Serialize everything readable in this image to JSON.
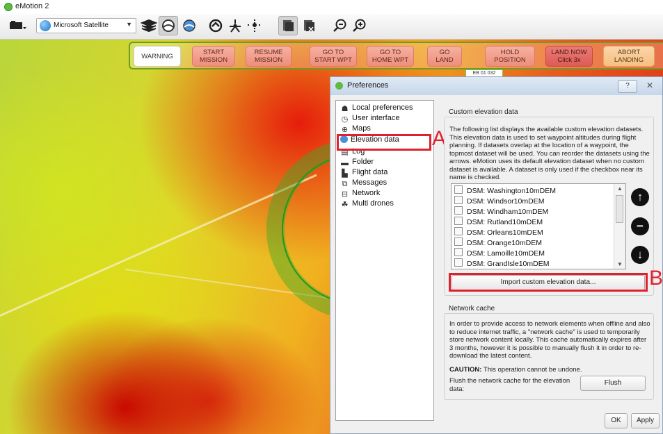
{
  "app": {
    "title": "eMotion 2"
  },
  "toolbar": {
    "map_source": "Microsoft Satellite",
    "icons": [
      "drone-menu-icon",
      "layers-icon",
      "elevation-icon",
      "elevation-alt-icon",
      "launch-icon",
      "hover-drone-icon",
      "altitude-drone-icon",
      "flight-plan-icon",
      "flight-plan-alt-icon",
      "zoom-out-icon",
      "zoom-in-icon"
    ]
  },
  "commands": [
    {
      "line1": "WARNING",
      "line2": ""
    },
    {
      "line1": "START",
      "line2": "MISSION"
    },
    {
      "line1": "RESUME",
      "line2": "MISSION"
    },
    {
      "line1": "GO TO",
      "line2": "START WPT"
    },
    {
      "line1": "GO TO",
      "line2": "HOME WPT"
    },
    {
      "line1": "GO",
      "line2": "LAND"
    },
    {
      "line1": "HOLD",
      "line2": "POSITION"
    },
    {
      "line1": "LAND NOW",
      "line2": "Click 3x"
    },
    {
      "line1": "ABORT",
      "line2": "LANDING"
    }
  ],
  "map_tag": "EB 01 032",
  "dialog": {
    "title": "Preferences",
    "help": "?",
    "close": "✕",
    "nav": [
      {
        "label": "Local preferences",
        "icon": "people-icon"
      },
      {
        "label": "User interface",
        "icon": "clock-icon"
      },
      {
        "label": "Maps",
        "icon": "maps-icon"
      },
      {
        "label": "Elevation data",
        "icon": "elevation-icon"
      },
      {
        "label": "Log",
        "icon": "log-icon"
      },
      {
        "label": "Folder",
        "icon": "folder-icon"
      },
      {
        "label": "Flight data",
        "icon": "flight-data-icon"
      },
      {
        "label": "Messages",
        "icon": "messages-icon"
      },
      {
        "label": "Network",
        "icon": "network-icon"
      },
      {
        "label": "Multi drones",
        "icon": "multi-drones-icon"
      }
    ],
    "annotation_a": "A",
    "annotation_b": "B",
    "custom_elevation": {
      "title": "Custom elevation data",
      "description": "The following list displays the available custom elevation datasets. This elevation data is used to set waypoint altitudes during flight planning. If datasets overlap at the location of a waypoint, the topmost dataset will be used. You can reorder the datasets using the arrows. eMotion uses its default elevation dataset when no custom dataset is available. A dataset is only used if the checkbox near its name is checked.",
      "datasets": [
        "DSM: Washington10mDEM",
        "DSM: Windsor10mDEM",
        "DSM: Windham10mDEM",
        "DSM: Rutland10mDEM",
        "DSM: Orleans10mDEM",
        "DSM: Orange10mDEM",
        "DSM: Lamoille10mDEM",
        "DSM: GrandIsle10mDEM"
      ],
      "import_button": "Import custom elevation data..."
    },
    "network_cache": {
      "title": "Network cache",
      "description": "In order to provide access to network elements when offline and also to reduce internet traffic, a \"network cache\" is used to temporarily store network content locally. This cache automatically expires after 3 months, however it is possible to manually flush it in order to re-download the latest content.",
      "caution_label": "CAUTION:",
      "caution_text": "This operation cannot be undone.",
      "flush_label": "Flush the network cache for the elevation data:",
      "flush_button": "Flush"
    },
    "ok_button": "OK",
    "apply_button": "Apply"
  }
}
